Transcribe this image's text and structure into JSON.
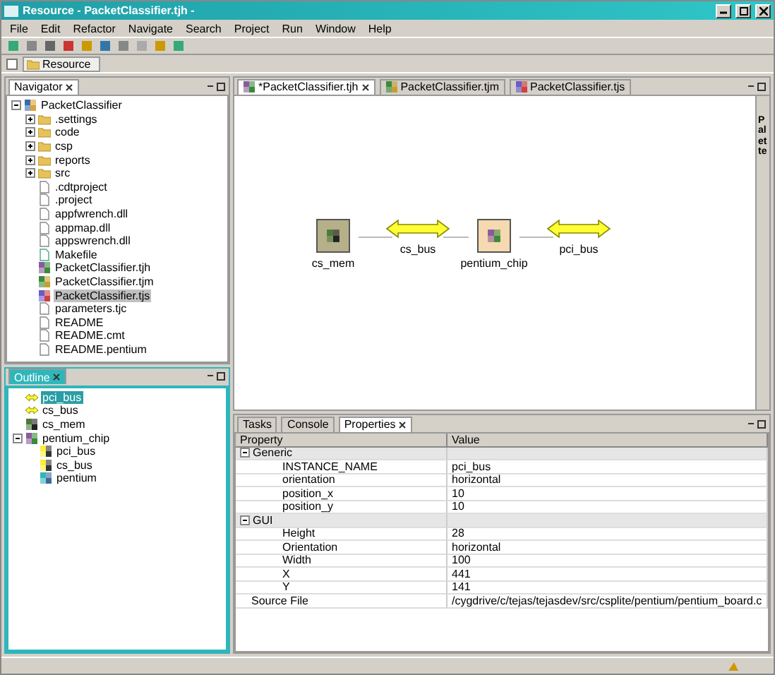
{
  "window": {
    "title": "Resource - PacketClassifier.tjh -"
  },
  "menu": [
    "File",
    "Edit",
    "Refactor",
    "Navigate",
    "Search",
    "Project",
    "Run",
    "Window",
    "Help"
  ],
  "perspective": {
    "label": "Resource",
    "selected": true
  },
  "navigator": {
    "title": "Navigator",
    "tree": [
      {
        "label": "PacketClassifier",
        "kind": "project",
        "expanded": true,
        "selected": false,
        "children": [
          {
            "label": ".settings",
            "kind": "folder",
            "expanded": false,
            "selected": false
          },
          {
            "label": "code",
            "kind": "folder",
            "expanded": false,
            "selected": false
          },
          {
            "label": "csp",
            "kind": "folder",
            "expanded": false,
            "selected": false
          },
          {
            "label": "reports",
            "kind": "folder",
            "expanded": false,
            "selected": false
          },
          {
            "label": "src",
            "kind": "folder",
            "expanded": false,
            "selected": false
          },
          {
            "label": ".cdtproject",
            "kind": "file",
            "selected": false
          },
          {
            "label": ".project",
            "kind": "file",
            "selected": false
          },
          {
            "label": "appfwrench.dll",
            "kind": "file",
            "selected": false
          },
          {
            "label": "appmap.dll",
            "kind": "file",
            "selected": false
          },
          {
            "label": "appswrench.dll",
            "kind": "file",
            "selected": false
          },
          {
            "label": "Makefile",
            "kind": "makefile",
            "selected": false
          },
          {
            "label": "PacketClassifier.tjh",
            "kind": "chip",
            "selected": false
          },
          {
            "label": "PacketClassifier.tjm",
            "kind": "map",
            "selected": false
          },
          {
            "label": "PacketClassifier.tjs",
            "kind": "sys",
            "selected": true
          },
          {
            "label": "parameters.tjc",
            "kind": "file",
            "selected": false
          },
          {
            "label": "README",
            "kind": "file",
            "selected": false
          },
          {
            "label": "README.cmt",
            "kind": "file",
            "selected": false
          },
          {
            "label": "README.pentium",
            "kind": "file",
            "selected": false
          }
        ]
      }
    ]
  },
  "outline": {
    "title": "Outline",
    "tree": [
      {
        "label": "pci_bus",
        "kind": "bus",
        "selected": true
      },
      {
        "label": "cs_bus",
        "kind": "bus",
        "selected": false
      },
      {
        "label": "cs_mem",
        "kind": "mem",
        "selected": false
      },
      {
        "label": "pentium_chip",
        "kind": "chip",
        "expanded": true,
        "selected": false,
        "children": [
          {
            "label": "pci_bus",
            "kind": "port",
            "selected": false
          },
          {
            "label": "cs_bus",
            "kind": "port",
            "selected": false
          },
          {
            "label": "pentium",
            "kind": "cpu",
            "selected": false
          }
        ]
      }
    ]
  },
  "editor": {
    "tabs": [
      {
        "label": "*PacketClassifier.tjh",
        "kind": "chip",
        "selected": true
      },
      {
        "label": "PacketClassifier.tjm",
        "kind": "map",
        "selected": false
      },
      {
        "label": "PacketClassifier.tjs",
        "kind": "sys",
        "selected": false
      }
    ],
    "palette": "Palette",
    "nodes": [
      {
        "label": "cs_mem",
        "kind": "mem"
      },
      {
        "label": "cs_bus",
        "kind": "bus"
      },
      {
        "label": "pentium_chip",
        "kind": "chip"
      },
      {
        "label": "pci_bus",
        "kind": "bus"
      }
    ]
  },
  "bottom": {
    "tabs": [
      {
        "label": "Tasks",
        "selected": false
      },
      {
        "label": "Console",
        "selected": false
      },
      {
        "label": "Properties",
        "selected": true
      }
    ],
    "columns": [
      "Property",
      "Value"
    ],
    "rows": [
      {
        "kind": "category",
        "label": "Generic",
        "expanded": true,
        "children": [
          {
            "kind": "property",
            "label": "INSTANCE_NAME",
            "value": "pci_bus"
          },
          {
            "kind": "property",
            "label": "orientation",
            "value": "horizontal"
          },
          {
            "kind": "property",
            "label": "position_x",
            "value": "10"
          },
          {
            "kind": "property",
            "label": "position_y",
            "value": "10"
          }
        ]
      },
      {
        "kind": "category",
        "label": "GUI",
        "expanded": true,
        "children": [
          {
            "kind": "property",
            "label": "Height",
            "value": "28"
          },
          {
            "kind": "property",
            "label": "Orientation",
            "value": "horizontal"
          },
          {
            "kind": "property",
            "label": "Width",
            "value": "100"
          },
          {
            "kind": "property",
            "label": "X",
            "value": "441"
          },
          {
            "kind": "property",
            "label": "Y",
            "value": "141"
          }
        ]
      },
      {
        "kind": "property",
        "label": "Source File",
        "value": "/cygdrive/c/tejas/tejasdev/src/csplite/pentium/pentium_board.c"
      }
    ]
  }
}
